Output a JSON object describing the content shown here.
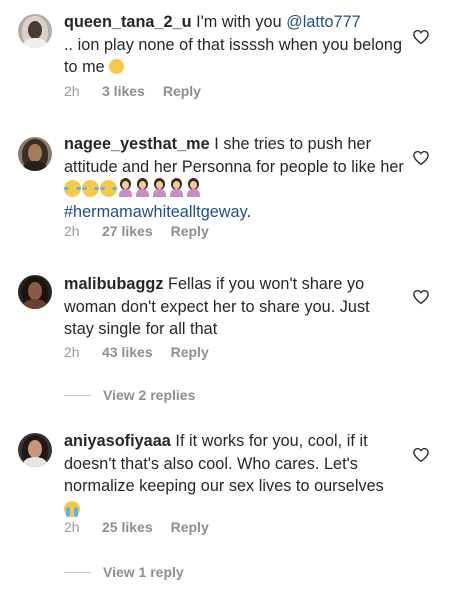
{
  "comments": [
    {
      "username": "queen_tana_2_u",
      "text_before_mention": " I'm with you ",
      "mention": "@latto777",
      "text_after_mention": ".. ion play none of that issssh when you belong to me ",
      "emoji_end": "smiling-face-icon",
      "time": "2h",
      "likes": "3 likes",
      "reply": "Reply"
    },
    {
      "username": "nagee_yesthat_me",
      "text": " I she tries to push her attitude and her Personna for people to like her",
      "emojis": [
        "laughing-crying-icon",
        "laughing-crying-icon",
        "laughing-crying-icon",
        "woman-shrugging-icon",
        "woman-shrugging-icon",
        "woman-shrugging-icon",
        "woman-shrugging-icon",
        "woman-shrugging-icon"
      ],
      "hashtag": "#hermamawhitealltgeway",
      "hashtag_after": ".",
      "time": "2h",
      "likes": "27 likes",
      "reply": "Reply"
    },
    {
      "username": "malibubaggz",
      "text": " Fellas if you won't share yo woman don't expect her to share you. Just stay single for all that",
      "time": "2h",
      "likes": "43 likes",
      "reply": "Reply",
      "view_replies": "View 2 replies"
    },
    {
      "username": "aniyasofiyaaa",
      "text": " If it works for you, cool, if it doesn't that's also cool. Who cares. Let's normalize keeping our sex lives to ourselves ",
      "emoji_end": "loudly-crying-icon",
      "time": "2h",
      "likes": "25 likes",
      "reply": "Reply",
      "view_replies": "View 1 reply"
    }
  ],
  "colors": {
    "text": "#262626",
    "meta": "#8e8e8e",
    "link": "#1e4f8a",
    "divider": "#c7c7c7"
  }
}
